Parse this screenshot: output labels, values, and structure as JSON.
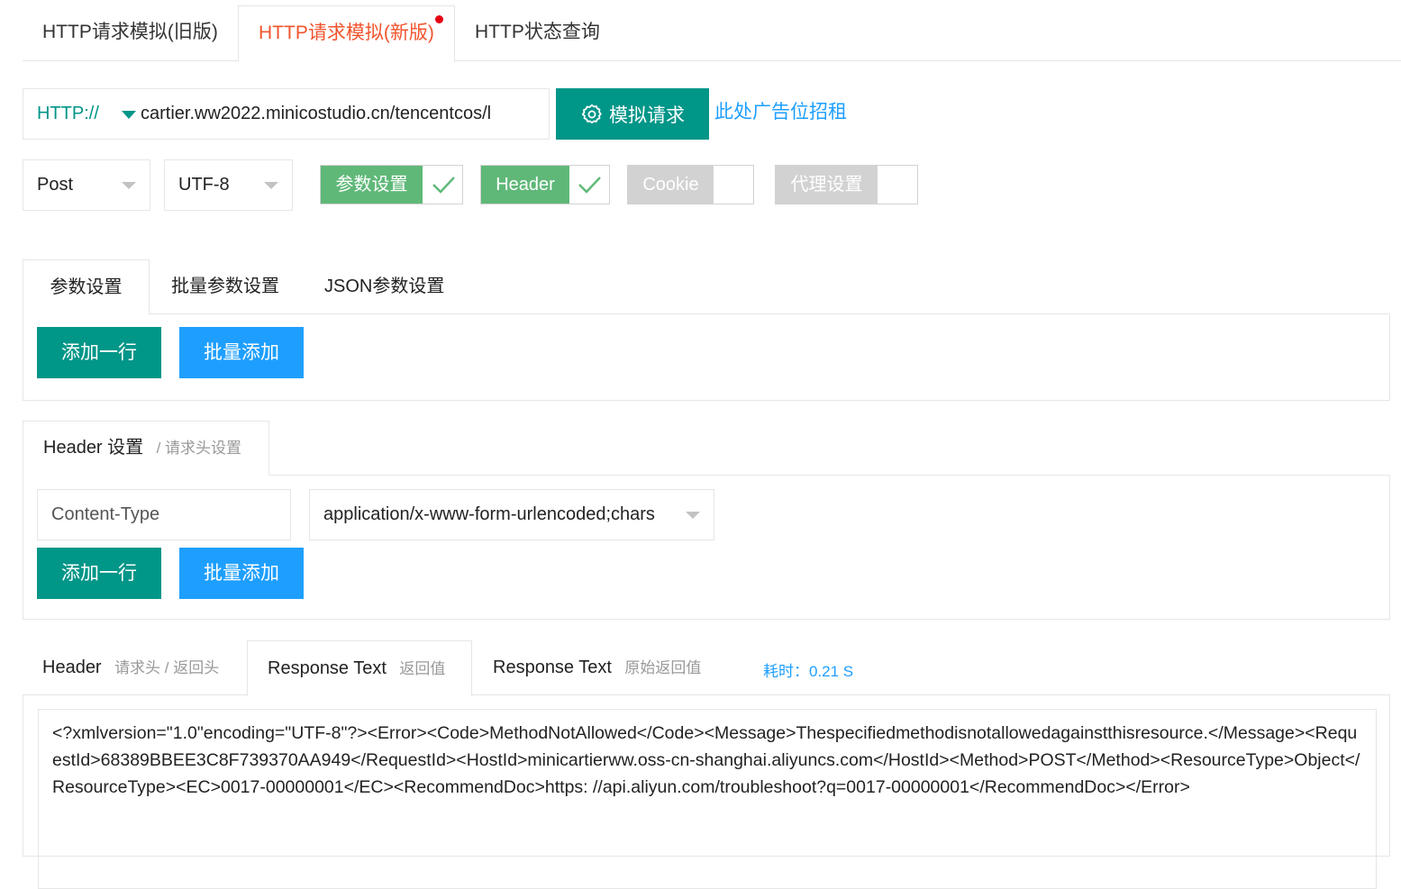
{
  "top_tabs": [
    {
      "label": "HTTP请求模拟(旧版)"
    },
    {
      "label": "HTTP请求模拟(新版)"
    },
    {
      "label": "HTTP状态查询"
    }
  ],
  "url_bar": {
    "protocol": "HTTP://",
    "url": "cartier.ww2022.minicostudio.cn/tencentcos/l",
    "simulate_label": "模拟请求",
    "ad_text": "此处广告位招租"
  },
  "method_select": {
    "value": "Post"
  },
  "charset_select": {
    "value": "UTF-8"
  },
  "toggles": [
    {
      "label": "参数设置",
      "checked": true
    },
    {
      "label": "Header",
      "checked": true
    },
    {
      "label": "Cookie",
      "checked": false
    },
    {
      "label": "代理设置",
      "checked": false
    }
  ],
  "param_tabs": [
    {
      "label": "参数设置"
    },
    {
      "label": "批量参数设置"
    },
    {
      "label": "JSON参数设置"
    }
  ],
  "buttons": {
    "add_row": "添加一行",
    "batch_add": "批量添加"
  },
  "header_settings": {
    "title": "Header 设置",
    "subtitle": "/ 请求头设置",
    "key_value": "Content-Type",
    "value_value": "application/x-www-form-urlencoded;chars"
  },
  "response_tabs": [
    {
      "label": "Header",
      "sub": "请求头 / 返回头"
    },
    {
      "label": "Response Text",
      "sub": "返回值"
    },
    {
      "label": "Response Text",
      "sub": "原始返回值"
    }
  ],
  "timing": "耗时：0.21 S",
  "response_text": "<?xmlversion=\"1.0\"encoding=\"UTF-8\"?><Error><Code>MethodNotAllowed</Code><Message>Thespecifiedmethodisnotallowedagainstthisresource.</Message><RequestId>68389BBEE3C8F739370AA949</RequestId><HostId>minicartierww.oss-cn-shanghai.aliyuncs.com</HostId><Method>POST</Method><ResourceType>Object</ResourceType><EC>0017-00000001</EC><RecommendDoc>https: //api.aliyun.com/troubleshoot?q=0017-00000001</RecommendDoc></Error>",
  "colors": {
    "teal": "#009688",
    "blue": "#1e9fff",
    "green": "#5fb878",
    "orange_active": "#f0542d",
    "disabled": "#d2d2d2"
  }
}
